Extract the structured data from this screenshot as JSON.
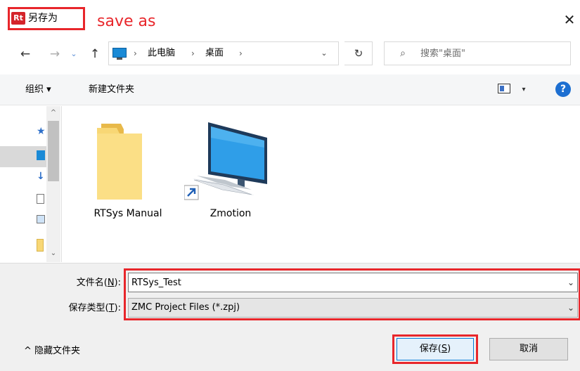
{
  "window": {
    "app_icon": "Rt",
    "title": "另存为",
    "annotation": "save as",
    "close_label": "✕"
  },
  "nav": {
    "back_icon": "←",
    "forward_icon": "→",
    "recent_icon": "⌄",
    "up_icon": "↑",
    "breadcrumb": [
      "此电脑",
      "桌面"
    ],
    "separator": "›",
    "dropdown_icon": "⌄",
    "refresh_icon": "↻",
    "search_icon": "⌕",
    "search_placeholder": "搜索\"桌面\""
  },
  "toolbar": {
    "organize_label": "组织 ▾",
    "new_folder_label": "新建文件夹",
    "view_dropdown": "▾",
    "help_label": "?"
  },
  "nav_pane": {
    "scroll_up": "^",
    "scroll_down": "⌄"
  },
  "files": [
    {
      "name": "RTSys Manual",
      "icon": "folder-icon"
    },
    {
      "name": "Zmotion",
      "icon": "computer-shortcut-icon"
    }
  ],
  "form": {
    "filename_label_prefix": "文件名(",
    "filename_label_key": "N",
    "filename_label_suffix": "):",
    "filename_value": "RTSys_Test",
    "filetype_label_prefix": "保存类型(",
    "filetype_label_key": "T",
    "filetype_label_suffix": "):",
    "filetype_value": "ZMC Project Files (*.zpj)",
    "dropdown_icon": "⌄"
  },
  "footer": {
    "hide_folders_label": "^ 隐藏文件夹",
    "save_label_prefix": "保存(",
    "save_label_key": "S",
    "save_label_suffix": ")",
    "cancel_label": "取消"
  },
  "colors": {
    "annotation_red": "#e8262b",
    "accent_blue": "#0078d7",
    "folder_yellow": "#f8d775"
  }
}
